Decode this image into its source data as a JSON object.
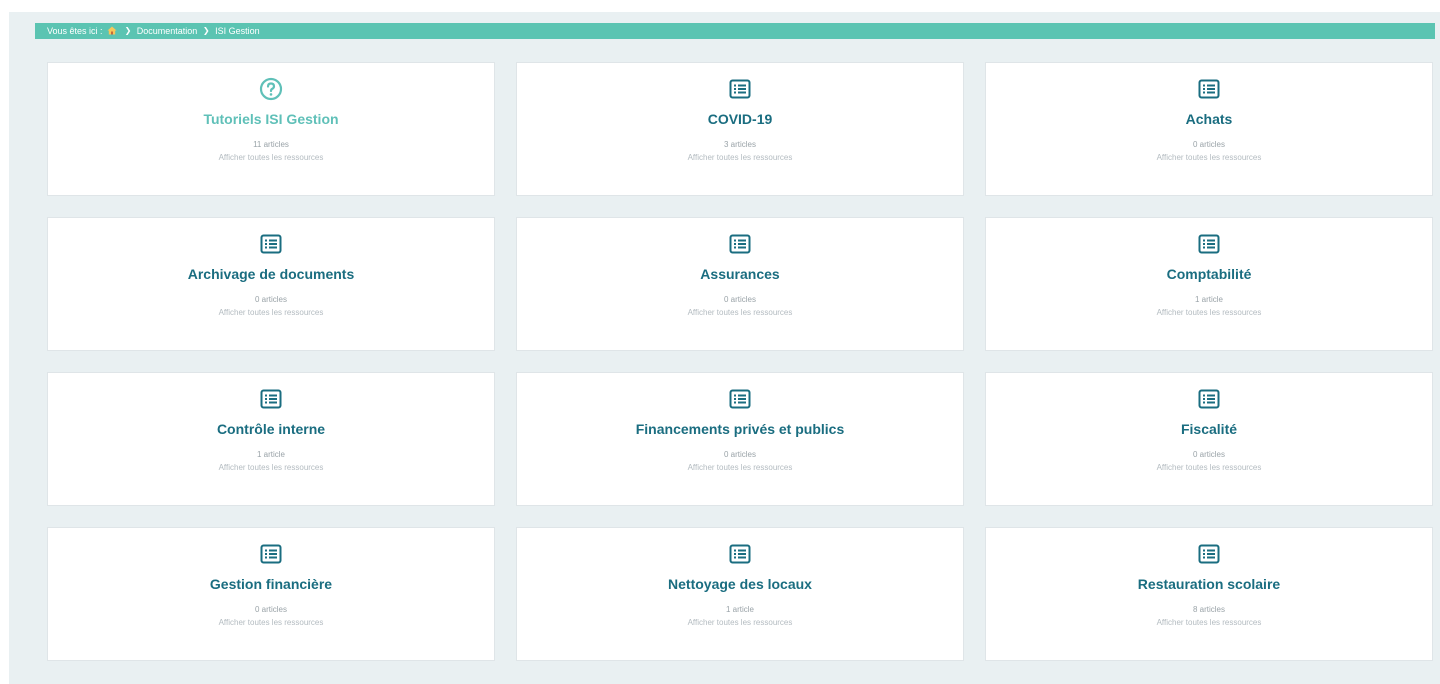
{
  "breadcrumb": {
    "prefix": "Vous êtes ici :",
    "items": [
      "Documentation",
      "ISI Gestion"
    ],
    "bar_color": "#5bc4b2",
    "home_icon": "home-icon"
  },
  "colors": {
    "title": "#1a6d80",
    "title_highlight": "#5fc0b8",
    "panel_bg": "#e9f0f2"
  },
  "categories": [
    {
      "title": "Tutoriels ISI Gestion",
      "count": "11 articles",
      "link": "Afficher toutes les ressources",
      "icon": "question-circle-icon"
    },
    {
      "title": "COVID-19",
      "count": "3 articles",
      "link": "Afficher toutes les ressources",
      "icon": "list-icon"
    },
    {
      "title": "Achats",
      "count": "0 articles",
      "link": "Afficher toutes les ressources",
      "icon": "list-icon"
    },
    {
      "title": "Archivage de documents",
      "count": "0 articles",
      "link": "Afficher toutes les ressources",
      "icon": "list-icon"
    },
    {
      "title": "Assurances",
      "count": "0 articles",
      "link": "Afficher toutes les ressources",
      "icon": "list-icon"
    },
    {
      "title": "Comptabilité",
      "count": "1 article",
      "link": "Afficher toutes les ressources",
      "icon": "list-icon"
    },
    {
      "title": "Contrôle interne",
      "count": "1 article",
      "link": "Afficher toutes les ressources",
      "icon": "list-icon"
    },
    {
      "title": "Financements privés et publics",
      "count": "0 articles",
      "link": "Afficher toutes les ressources",
      "icon": "list-icon"
    },
    {
      "title": "Fiscalité",
      "count": "0 articles",
      "link": "Afficher toutes les ressources",
      "icon": "list-icon"
    },
    {
      "title": "Gestion financière",
      "count": "0 articles",
      "link": "Afficher toutes les ressources",
      "icon": "list-icon"
    },
    {
      "title": "Nettoyage des locaux",
      "count": "1 article",
      "link": "Afficher toutes les ressources",
      "icon": "list-icon"
    },
    {
      "title": "Restauration scolaire",
      "count": "8 articles",
      "link": "Afficher toutes les ressources",
      "icon": "list-icon"
    }
  ]
}
